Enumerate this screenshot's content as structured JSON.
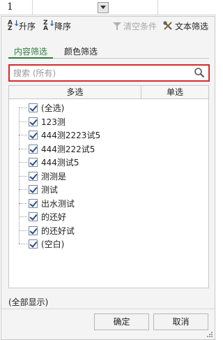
{
  "sheet": {
    "row_number": "1"
  },
  "toolbar": {
    "sort_asc": "升序",
    "sort_desc": "降序",
    "clear_conditions": "清空条件",
    "text_filter": "文本筛选"
  },
  "tabs": [
    {
      "label": "内容筛选",
      "active": true
    },
    {
      "label": "颜色筛选",
      "active": false
    }
  ],
  "search": {
    "placeholder": "搜索 (所有)",
    "value": ""
  },
  "list": {
    "columns": {
      "multi": "多选",
      "single": "单选"
    },
    "items": [
      {
        "label": "(全选)",
        "checked": true
      },
      {
        "label": "123测",
        "checked": true
      },
      {
        "label": "444测2223试5",
        "checked": true
      },
      {
        "label": "444测222试5",
        "checked": true
      },
      {
        "label": "444测试5",
        "checked": true
      },
      {
        "label": "测测是",
        "checked": true
      },
      {
        "label": "测试",
        "checked": true
      },
      {
        "label": "出水测试",
        "checked": true
      },
      {
        "label": "的还好",
        "checked": true
      },
      {
        "label": "的还好试",
        "checked": true
      },
      {
        "label": "(空白)",
        "checked": true
      }
    ]
  },
  "show_all": "(全部显示)",
  "buttons": {
    "ok": "确定",
    "cancel": "取消"
  },
  "colors": {
    "accent_tab": "#2f7d3a",
    "search_border": "#d62a2a"
  }
}
